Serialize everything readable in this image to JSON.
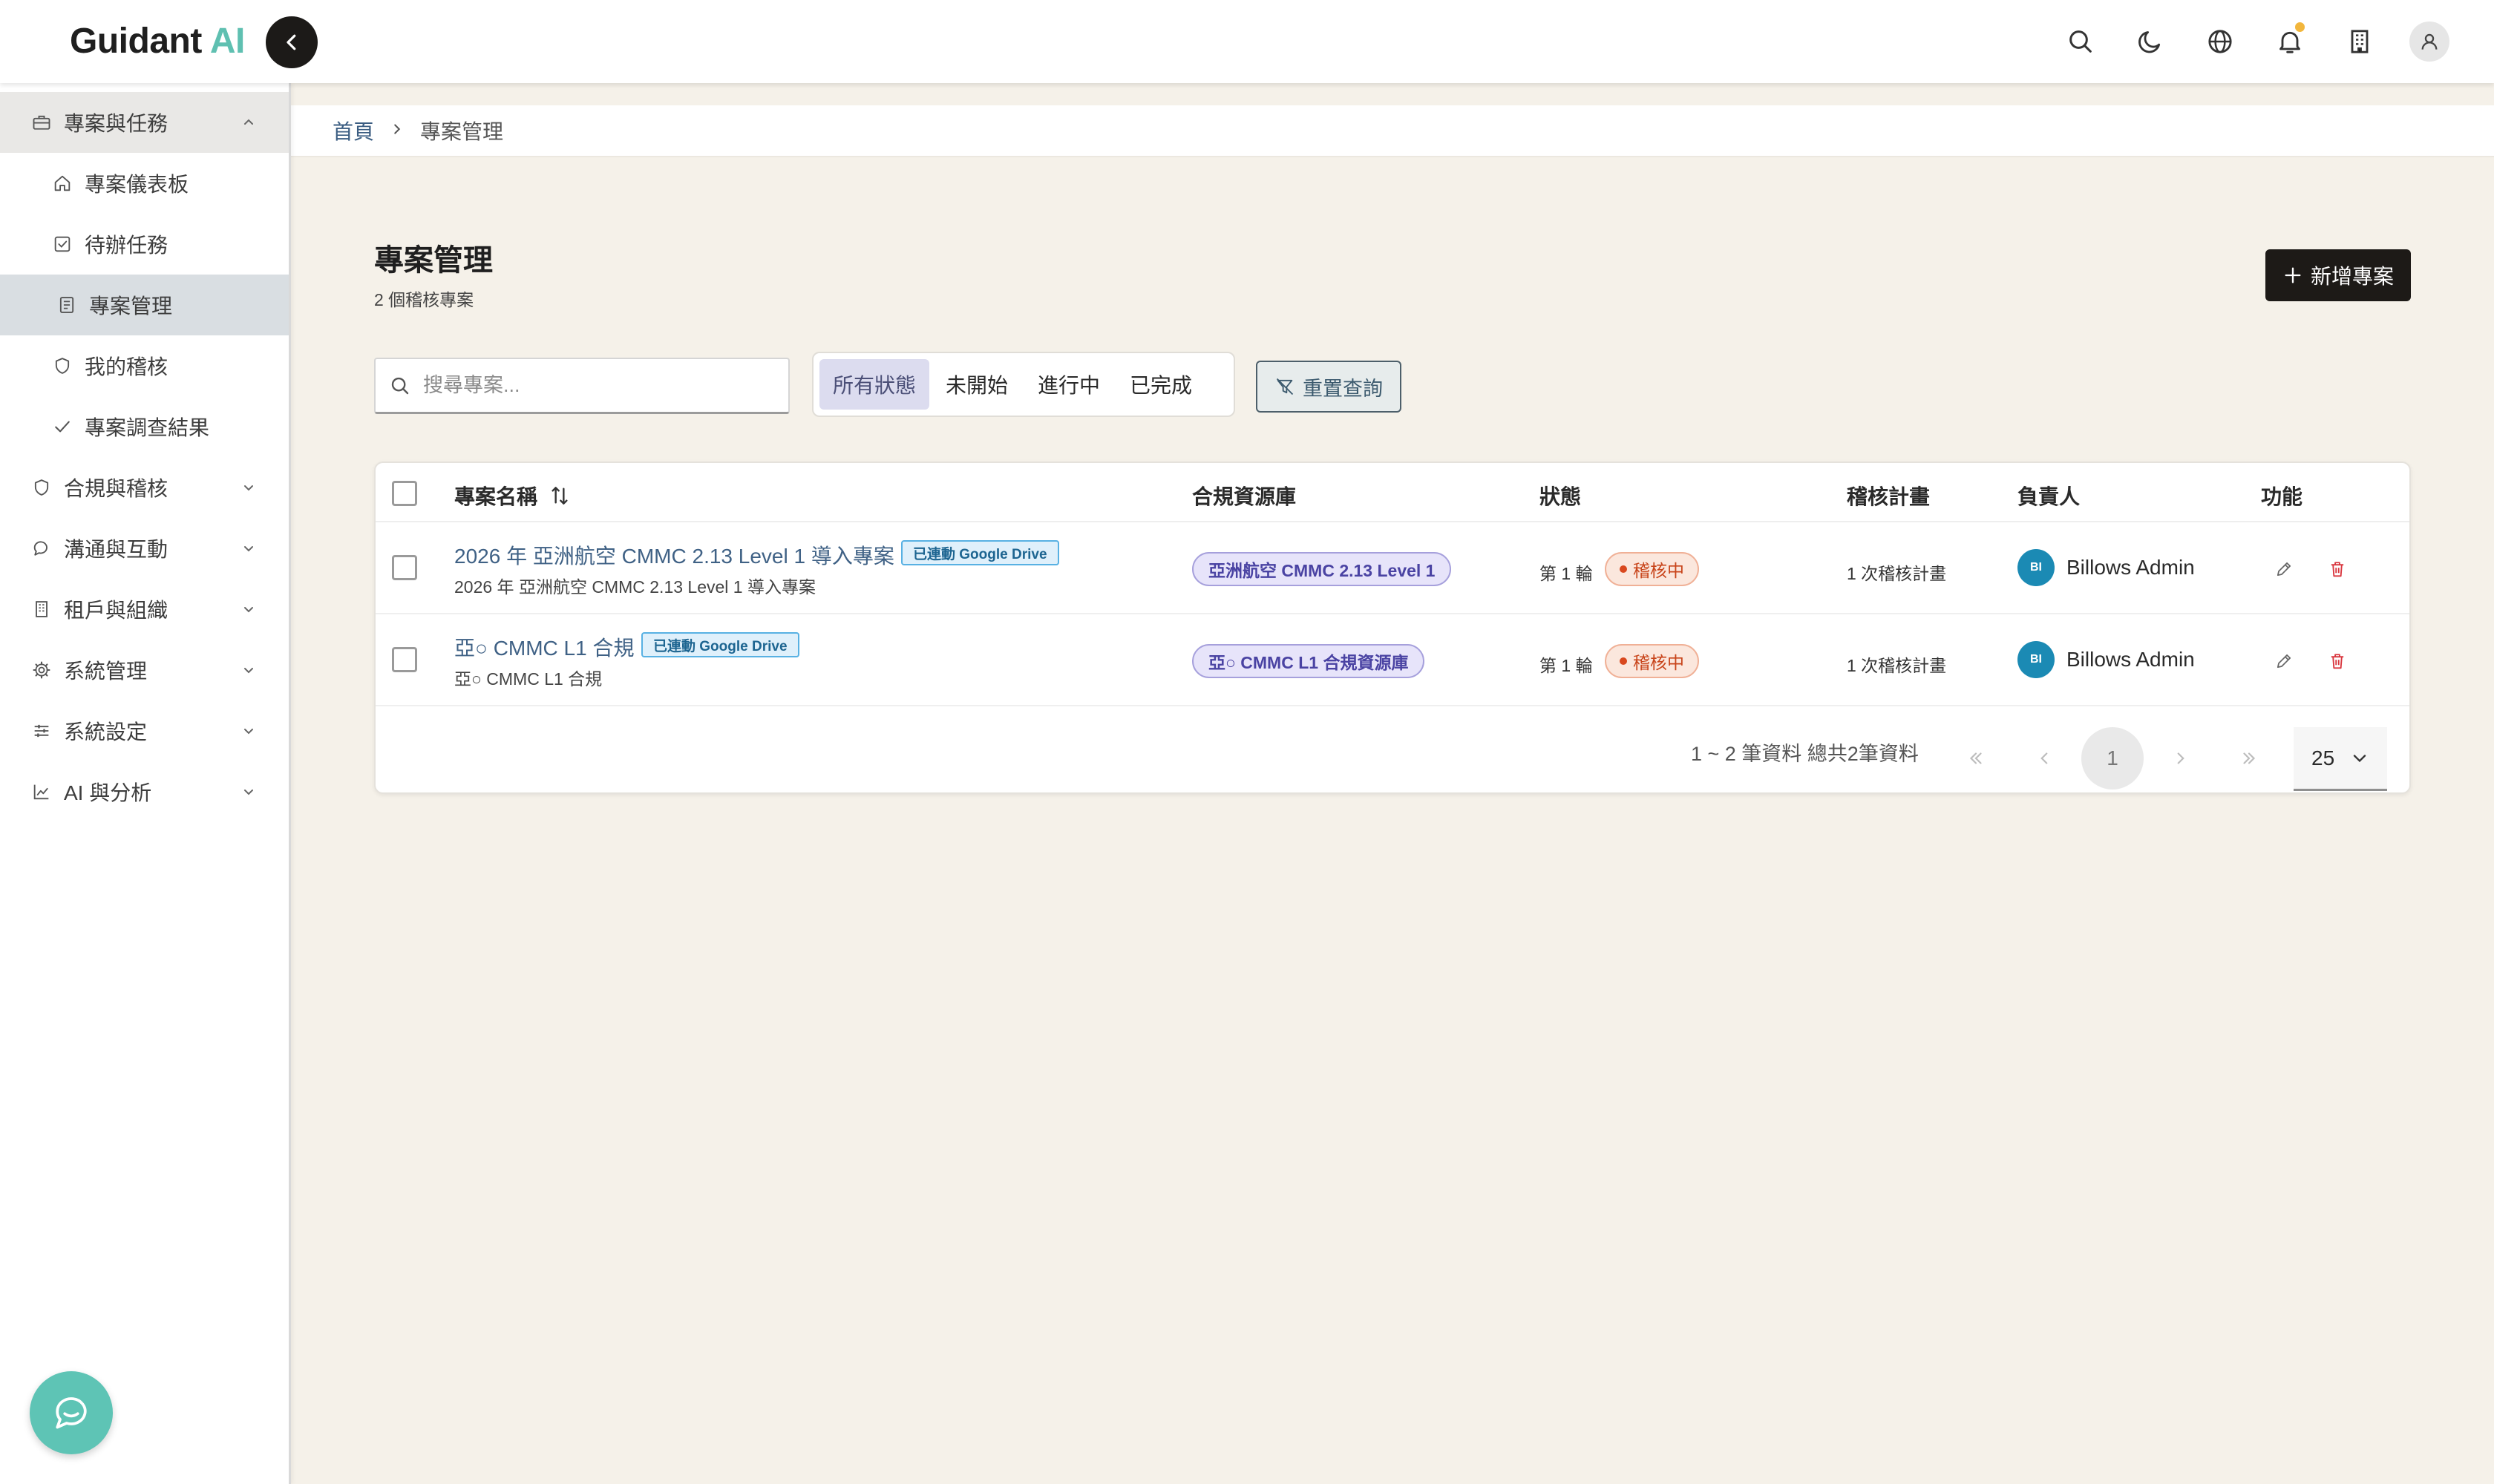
{
  "app": {
    "logo_main": "Guidant",
    "logo_accent": "AI"
  },
  "header_icons": [
    "search-icon",
    "moon-icon",
    "globe-icon",
    "bell-icon",
    "building-icon",
    "user-icon"
  ],
  "sidebar": {
    "groups": [
      {
        "label": "專案與任務",
        "icon": "briefcase-icon",
        "expanded": true,
        "items": [
          {
            "label": "專案儀表板",
            "icon": "home-icon"
          },
          {
            "label": "待辦任務",
            "icon": "checkbox-icon"
          },
          {
            "label": "專案管理",
            "icon": "document-icon",
            "active": true
          },
          {
            "label": "我的稽核",
            "icon": "shield-icon"
          },
          {
            "label": "專案調查結果",
            "icon": "check-icon"
          }
        ]
      },
      {
        "label": "合規與稽核",
        "icon": "shield-icon"
      },
      {
        "label": "溝通與互動",
        "icon": "chat-icon"
      },
      {
        "label": "租戶與組織",
        "icon": "building-icon"
      },
      {
        "label": "系統管理",
        "icon": "gear-icon"
      },
      {
        "label": "系統設定",
        "icon": "sliders-icon"
      },
      {
        "label": "AI 與分析",
        "icon": "chart-icon"
      }
    ]
  },
  "breadcrumb": {
    "home": "首頁",
    "current": "專案管理"
  },
  "page": {
    "title": "專案管理",
    "subtitle": "2 個稽核專案",
    "new_button": "新增專案"
  },
  "filters": {
    "search_placeholder": "搜尋專案...",
    "search_value": "",
    "status_tabs": [
      "所有狀態",
      "未開始",
      "進行中",
      "已完成"
    ],
    "active_status": "所有狀態",
    "reset_button": "重置查詢"
  },
  "table": {
    "columns": [
      "專案名稱",
      "合規資源庫",
      "狀態",
      "稽核計畫",
      "負責人",
      "功能"
    ],
    "rows": [
      {
        "name": "2026 年 亞洲航空 CMMC 2.13 Level 1 導入專案",
        "badge": "已連動 Google Drive",
        "description": "2026 年 亞洲航空 CMMC 2.13 Level 1 導入專案",
        "library": "亞洲航空 CMMC 2.13 Level 1",
        "round": "第 1 輪",
        "status": "稽核中",
        "plan": "1 次稽核計畫",
        "owner_initials": "BI",
        "owner_name": "Billows Admin"
      },
      {
        "name": "亞○ CMMC L1 合規",
        "badge": "已連動 Google Drive",
        "description": "亞○ CMMC L1 合規",
        "library": "亞○ CMMC L1 合規資源庫",
        "round": "第 1 輪",
        "status": "稽核中",
        "plan": "1 次稽核計畫",
        "owner_initials": "BI",
        "owner_name": "Billows Admin"
      }
    ]
  },
  "pagination": {
    "summary": "1 ~ 2 筆資料 總共2筆資料",
    "current_page": "1",
    "per_page": "25"
  },
  "colors": {
    "accent_teal": "#5fc0b1",
    "dark_button": "#1d1a17",
    "link_blue": "#3f6185",
    "status_orange": "#c8441a",
    "library_purple": "#4a43a3"
  }
}
